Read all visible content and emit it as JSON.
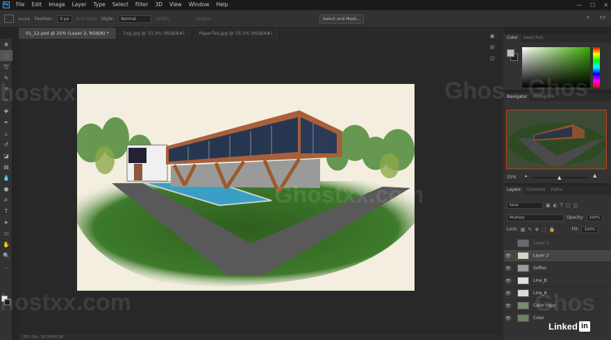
{
  "menubar": {
    "logo": "Ps",
    "items": [
      "File",
      "Edit",
      "Image",
      "Layer",
      "Type",
      "Select",
      "Filter",
      "3D",
      "View",
      "Window",
      "Help"
    ]
  },
  "options": {
    "feather_label": "Feather:",
    "feather_value": "0 px",
    "antialias_label": "Anti-alias",
    "style_label": "Style:",
    "style_value": "Normal",
    "width_label": "Width:",
    "height_label": "Height:",
    "mask_button": "Select and Mask..."
  },
  "tabs": [
    {
      "label": "01_12.psd @ 25% (Layer 2, RGB/8) *"
    },
    {
      "label": "Fog.jpg @ 33.3% (RGB/8#)"
    },
    {
      "label": "PaperTex.jpg @ 33.3% (RGB/8#)"
    }
  ],
  "status": "25%    Doc: 18.2M/66.3M",
  "color_panel": {
    "tabs": [
      "Color",
      "Swatches"
    ]
  },
  "navigator": {
    "tabs": [
      "Navigator",
      "Histogram"
    ],
    "zoom": "25%"
  },
  "layers_panel": {
    "tabs": [
      "Layers",
      "Channels",
      "Paths"
    ],
    "kind": "Kind",
    "blend_mode": "Multiply",
    "opacity_label": "Opacity:",
    "opacity_value": "100%",
    "lock_label": "Lock:",
    "fill_label": "Fill:",
    "fill_value": "100%",
    "layers": [
      {
        "name": "Layer 1",
        "visible": false,
        "thumb": "#6a6a6a"
      },
      {
        "name": "Layer 2",
        "visible": true,
        "selected": true,
        "thumb": "#d8d2c0"
      },
      {
        "name": "Soften",
        "visible": true,
        "thumb": "#9c9c9c"
      },
      {
        "name": "Line_B",
        "visible": true,
        "thumb": "#e0e0e0"
      },
      {
        "name": "Line_A",
        "visible": true,
        "thumb": "#dadada"
      },
      {
        "name": "Color copy",
        "visible": true,
        "thumb": "#7a8a70"
      },
      {
        "name": "Color",
        "visible": true,
        "thumb": "#6d8060"
      }
    ]
  },
  "watermarks": [
    "Ghos",
    "Ghos",
    "Ghostxx.com",
    "hostxx.com",
    "hostxx.com",
    "Ghos"
  ],
  "linkedin": {
    "text": "Linked",
    "box": "in"
  },
  "colors": {
    "accent": "#31a8ff",
    "navigator_frame": "#c23e1b"
  }
}
